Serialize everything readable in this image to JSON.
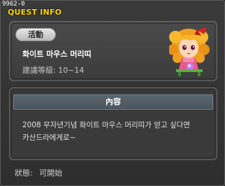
{
  "window": {
    "quest_id": "9962-0",
    "title": "QUEST INFO"
  },
  "header": {
    "tag_label": "活動",
    "quest_name": "화이트 마우스 머리띠",
    "level_label": "建議等級:",
    "level_range": "10~14"
  },
  "content": {
    "section_title": "內容",
    "body": "2008 무자년기념 화이트 마우스 머리띠가 얻고 싶다면\n카산드라에게로~"
  },
  "status": {
    "label": "狀態:",
    "value": "可開始"
  },
  "colors": {
    "title": "#ffd800",
    "panel": "#3c3c3c",
    "section_header": "#4a545c"
  },
  "icons": {
    "npc_portrait": "girl-with-orange-hair-and-mouse-ears-icon"
  }
}
